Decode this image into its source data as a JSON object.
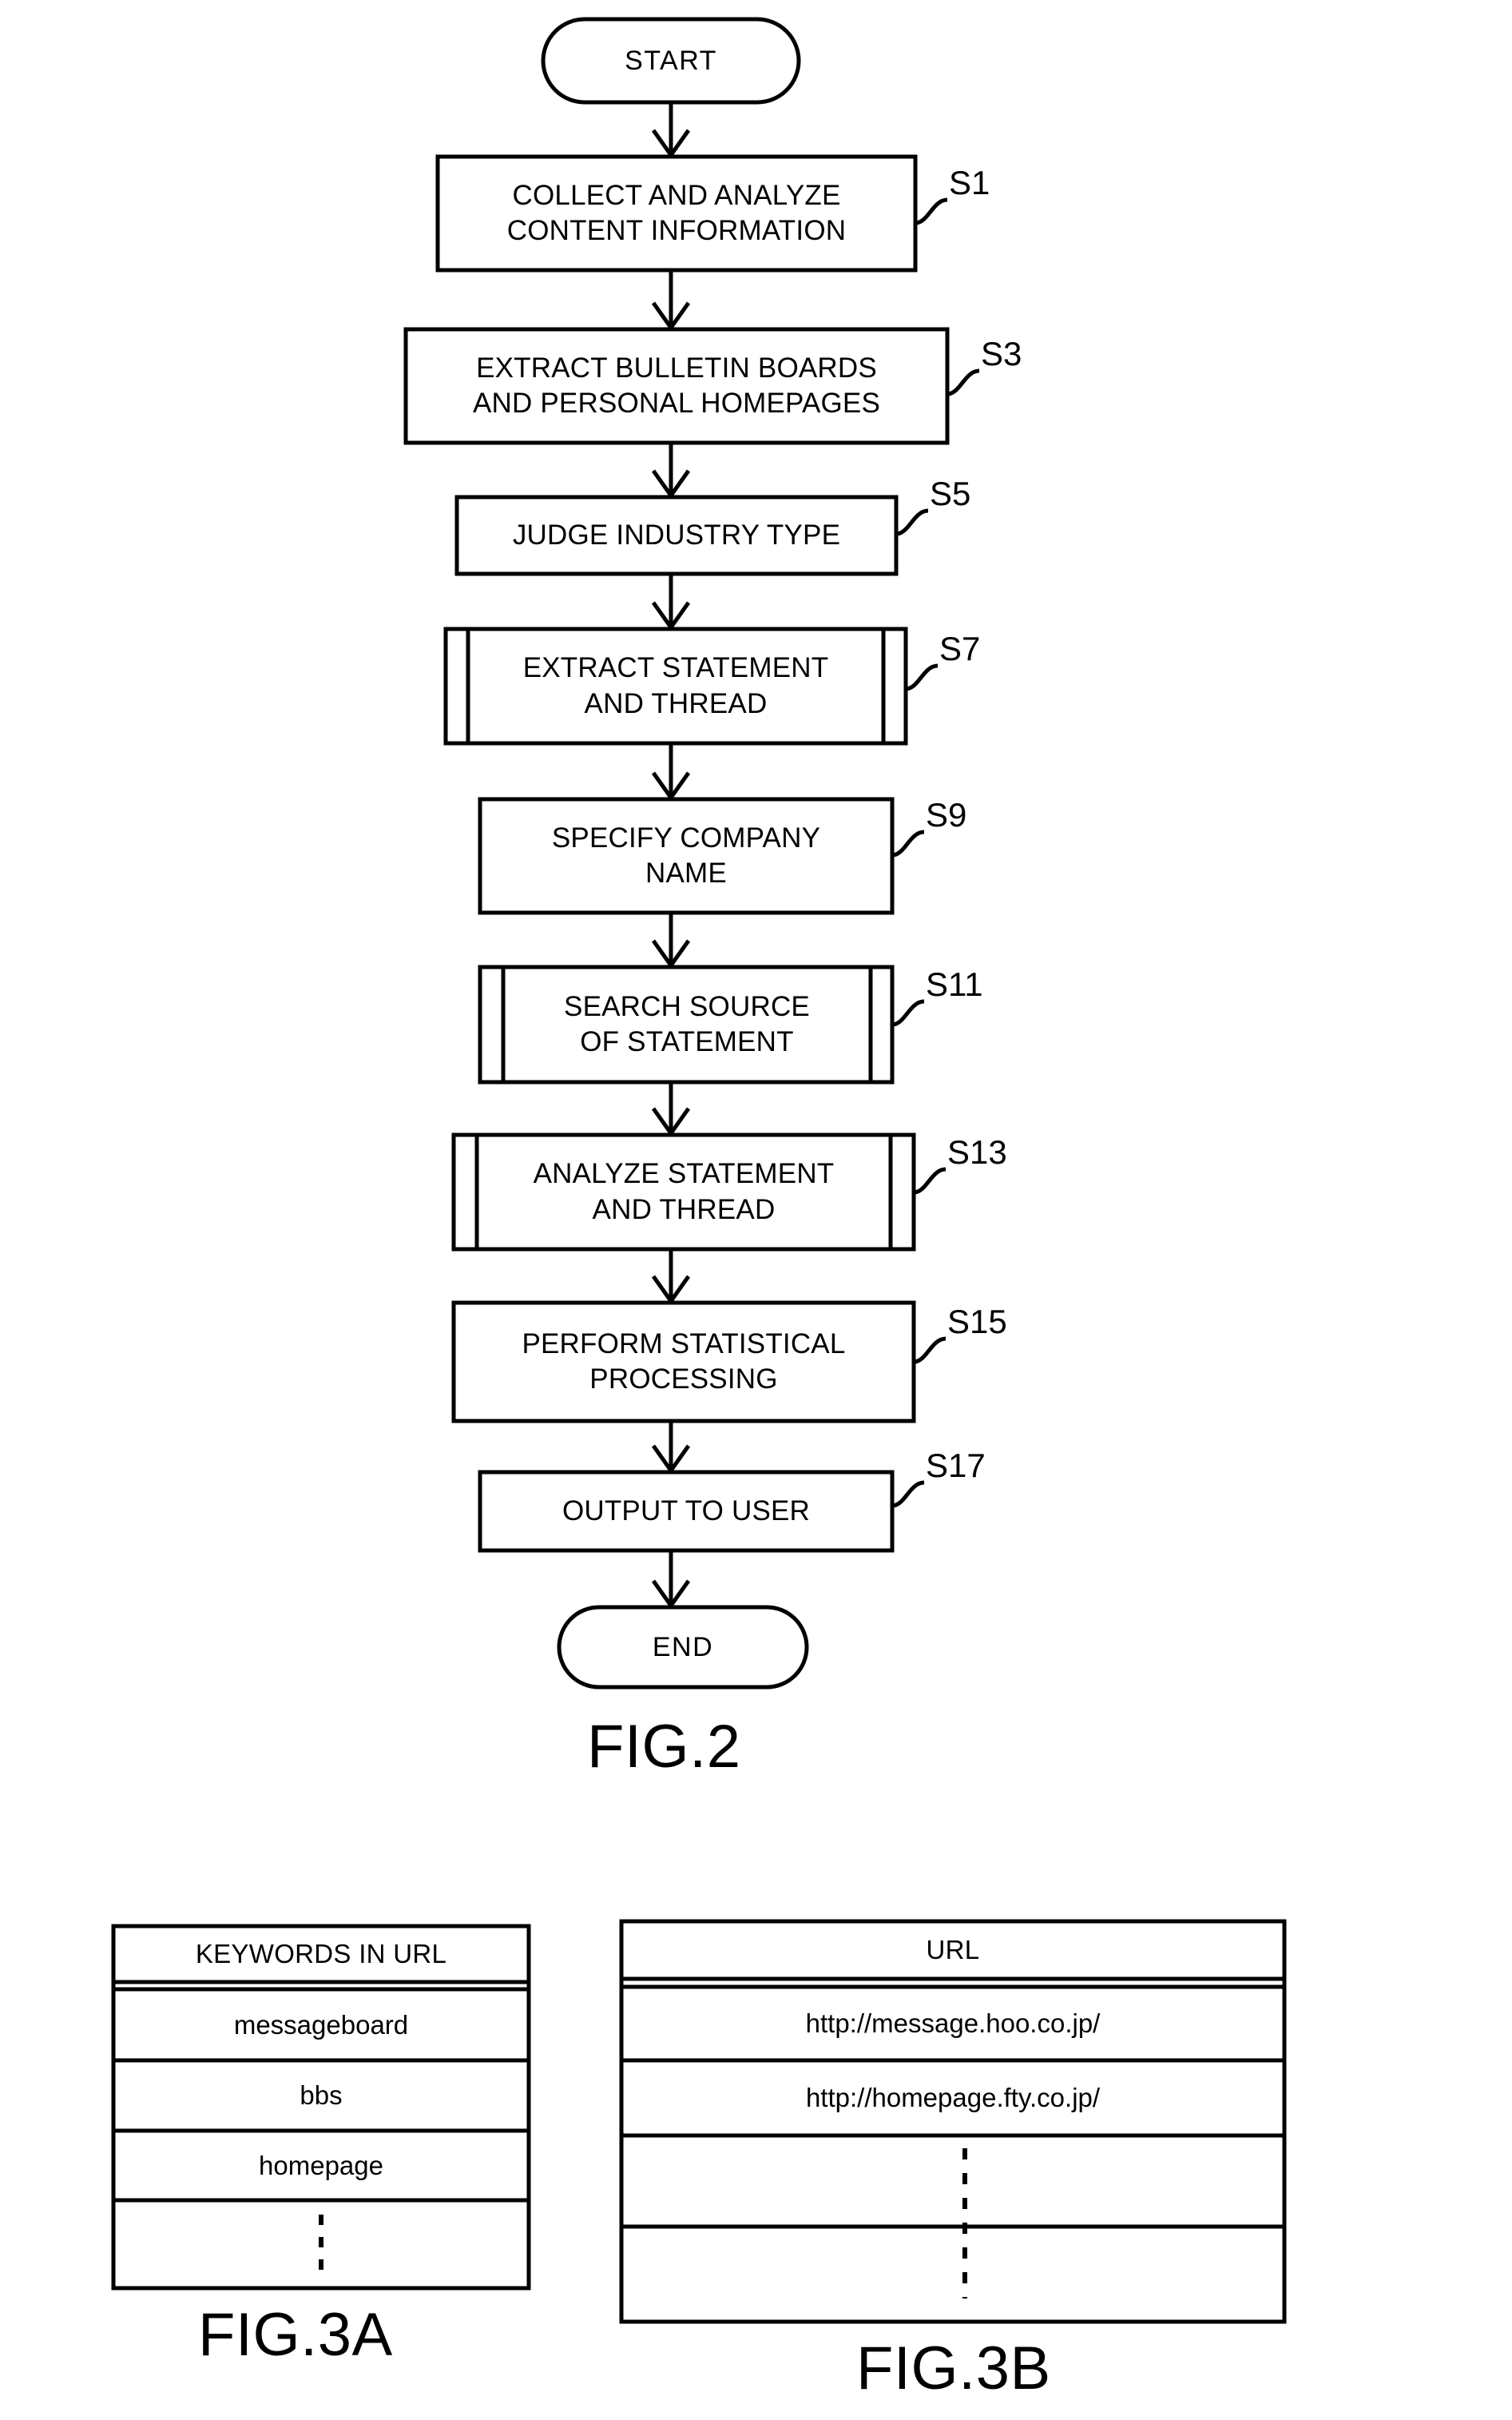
{
  "figure2": {
    "caption": "FIG.2",
    "nodes": [
      {
        "id": "start",
        "kind": "terminator",
        "label": "START",
        "step": ""
      },
      {
        "id": "s1",
        "kind": "process",
        "label": "COLLECT AND ANALYZE\nCONTENT INFORMATION",
        "step": "S1"
      },
      {
        "id": "s3",
        "kind": "process",
        "label": "EXTRACT BULLETIN BOARDS\nAND PERSONAL HOMEPAGES",
        "step": "S3"
      },
      {
        "id": "s5",
        "kind": "process",
        "label": "JUDGE INDUSTRY TYPE",
        "step": "S5"
      },
      {
        "id": "s7",
        "kind": "subroutine",
        "label": "EXTRACT STATEMENT\nAND THREAD",
        "step": "S7"
      },
      {
        "id": "s9",
        "kind": "process",
        "label": "SPECIFY COMPANY\nNAME",
        "step": "S9"
      },
      {
        "id": "s11",
        "kind": "subroutine",
        "label": "SEARCH SOURCE\nOF STATEMENT",
        "step": "S11"
      },
      {
        "id": "s13",
        "kind": "subroutine",
        "label": "ANALYZE STATEMENT\nAND THREAD",
        "step": "S13"
      },
      {
        "id": "s15",
        "kind": "process",
        "label": "PERFORM STATISTICAL\nPROCESSING",
        "step": "S15"
      },
      {
        "id": "s17",
        "kind": "process",
        "label": "OUTPUT TO USER",
        "step": "S17"
      },
      {
        "id": "end",
        "kind": "terminator",
        "label": "END",
        "step": ""
      }
    ],
    "node_labels": {
      "start": "START",
      "s1_line1": "COLLECT AND ANALYZE",
      "s1_line2": "CONTENT INFORMATION",
      "s3_line1": "EXTRACT BULLETIN BOARDS",
      "s3_line2": "AND PERSONAL HOMEPAGES",
      "s5_line1": "JUDGE INDUSTRY TYPE",
      "s7_line1": "EXTRACT STATEMENT",
      "s7_line2": "AND THREAD",
      "s9_line1": "SPECIFY COMPANY",
      "s9_line2": "NAME",
      "s11_line1": "SEARCH SOURCE",
      "s11_line2": "OF STATEMENT",
      "s13_line1": "ANALYZE STATEMENT",
      "s13_line2": "AND THREAD",
      "s15_line1": "PERFORM STATISTICAL",
      "s15_line2": "PROCESSING",
      "s17_line1": "OUTPUT TO USER",
      "end": "END"
    },
    "step_labels": {
      "s1": "S1",
      "s3": "S3",
      "s5": "S5",
      "s7": "S7",
      "s9": "S9",
      "s11": "S11",
      "s13": "S13",
      "s15": "S15",
      "s17": "S17"
    }
  },
  "figure3a": {
    "caption": "FIG.3A",
    "header": "KEYWORDS IN URL",
    "rows": [
      "messageboard",
      "bbs",
      "homepage",
      "⋮"
    ],
    "rows_display": {
      "r0": "messageboard",
      "r1": "bbs",
      "r2": "homepage",
      "r3": ""
    },
    "continuation_marker": "vertical-dashed-line"
  },
  "figure3b": {
    "caption": "FIG.3B",
    "header": "URL",
    "rows": [
      "http://message.hoo.co.jp/",
      "http://homepage.fty.co.jp/",
      "",
      ""
    ],
    "rows_display": {
      "r0": "http://message.hoo.co.jp/",
      "r1": "http://homepage.fty.co.jp/",
      "r2": "",
      "r3": ""
    },
    "continuation_marker": "vertical-dashed-line"
  },
  "colors": {
    "ink": "#000000",
    "paper": "#ffffff"
  }
}
